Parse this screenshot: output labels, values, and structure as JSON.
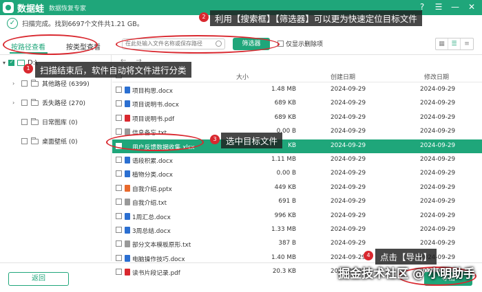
{
  "window": {
    "app_name": "数据蛙",
    "app_subtitle": "数据恢复专家",
    "controls": [
      "?",
      "☰",
      "—",
      "✕"
    ]
  },
  "status": {
    "text": "扫描完成。找到6697个文件共1.21 GB。"
  },
  "tabs": [
    {
      "label": "按路径查看",
      "active": true
    },
    {
      "label": "按类型查看",
      "active": false
    }
  ],
  "search": {
    "placeholder": "在此处输入文件名称或保存路径"
  },
  "filter_button": "筛选器",
  "only_deleted": {
    "label": "仅显示删除项",
    "checked": false
  },
  "sidebar": {
    "root_label": "D:\\",
    "items": [
      {
        "label": "其他路径 (6399)",
        "expandable": true
      },
      {
        "label": "丢失路径 (270)",
        "expandable": true
      },
      {
        "label": "日常图库 (0)",
        "expandable": false
      },
      {
        "label": "桌面壁纸 (0)",
        "expandable": false
      }
    ]
  },
  "table": {
    "headers": {
      "size": "大小",
      "created": "创建日期",
      "modified": "修改日期"
    },
    "rows": [
      {
        "name": "项目构思.docx",
        "size": "1.48 MB",
        "created": "2024-09-29",
        "modified": "2024-09-29",
        "type": "doc",
        "selected": false
      },
      {
        "name": "项目说明书.docx",
        "size": "689 KB",
        "created": "2024-09-29",
        "modified": "2024-09-29",
        "type": "doc",
        "selected": false
      },
      {
        "name": "项目说明书.pdf",
        "size": "689 KB",
        "created": "2024-09-29",
        "modified": "2024-09-29",
        "type": "pdf",
        "selected": false
      },
      {
        "name": "信息备忘.txt",
        "size": "0.00 B",
        "created": "2024-09-29",
        "modified": "2024-09-29",
        "type": "txt",
        "selected": false
      },
      {
        "name": "用户反馈数据收集.xlsx",
        "size": "KB",
        "created": "2024-09-29",
        "modified": "2024-09-29",
        "type": "xls",
        "selected": true
      },
      {
        "name": "语段积累.docx",
        "size": "1.11 MB",
        "created": "2024-09-29",
        "modified": "2024-09-29",
        "type": "doc",
        "selected": false
      },
      {
        "name": "植物分类.docx",
        "size": "0.00 B",
        "created": "2024-09-29",
        "modified": "2024-09-29",
        "type": "doc",
        "selected": false
      },
      {
        "name": "自我介绍.pptx",
        "size": "449 KB",
        "created": "2024-09-29",
        "modified": "2024-09-29",
        "type": "ppt",
        "selected": false
      },
      {
        "name": "自我介绍.txt",
        "size": "691 B",
        "created": "2024-09-29",
        "modified": "2024-09-29",
        "type": "txt",
        "selected": false
      },
      {
        "name": "1周汇总.docx",
        "size": "996 KB",
        "created": "2024-09-29",
        "modified": "2024-09-29",
        "type": "doc",
        "selected": false
      },
      {
        "name": "3周总结.docx",
        "size": "1.33 MB",
        "created": "2024-09-29",
        "modified": "2024-09-29",
        "type": "doc",
        "selected": false
      },
      {
        "name": "部分文本模板原形.txt",
        "size": "387 B",
        "created": "2024-09-29",
        "modified": "2024-09-29",
        "type": "txt",
        "selected": false
      },
      {
        "name": "电脑操作技巧.docx",
        "size": "1.40 MB",
        "created": "2024-09-29",
        "modified": "2024-09-29",
        "type": "doc",
        "selected": false
      },
      {
        "name": "读书片段记录.pdf",
        "size": "20.3 KB",
        "created": "2024-09-29",
        "modified": "2024-09-29",
        "type": "pdf",
        "selected": false
      }
    ]
  },
  "footer": {
    "back_label": "返回",
    "export_label": "导出"
  },
  "annotations": {
    "n1": "1",
    "t1": "扫描结束后，软件自动将文件进行分类",
    "n2": "2",
    "t2": "利用【搜索框】【筛选器】可以更为快速定位目标文件",
    "n3": "3",
    "t3": "选中目标文件",
    "n4": "4",
    "t4": "点击【导出】"
  },
  "watermark": "掘金技术社区 @ 小明助手",
  "colors": {
    "accent": "#1fa67a",
    "annotation": "#d9282f",
    "doc": "#2b6fd1",
    "pdf": "#d9282f",
    "ppt": "#e8692c",
    "xls": "#1fa67a",
    "txt": "#999999"
  }
}
